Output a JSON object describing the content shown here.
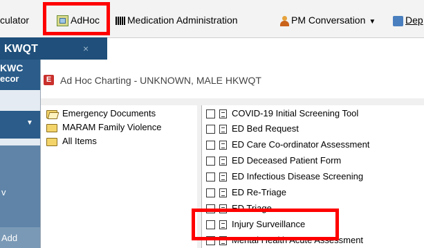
{
  "toolbar": {
    "calculator_label": "culator",
    "adhoc_label": "AdHoc",
    "med_admin_label": "Medication Administration",
    "pm_conversation_label": "PM Conversation",
    "departure_label": "Dep"
  },
  "patient_tab": {
    "label": "KWQT",
    "close": "×"
  },
  "sidebar": {
    "name": "KWC",
    "sub": "ecor",
    "w": "v",
    "add": "Add"
  },
  "dialog": {
    "title": "Ad Hoc Charting - UNKNOWN, MALE HKWQT",
    "app_icon_letter": "E",
    "folders": [
      "Emergency Documents",
      "MARAM Family Violence",
      "All Items"
    ],
    "forms": [
      "COVID-19 Initial Screening Tool",
      "ED Bed Request",
      "ED Care Co-ordinator Assessment",
      "ED Deceased Patient Form",
      "ED Infectious Disease Screening",
      "ED Re-Triage",
      "ED Triage",
      "Injury Surveillance",
      "Mental Health Acute Assessment"
    ]
  },
  "colors": {
    "highlight": "#ff0000",
    "header_blue": "#1f4f7a"
  }
}
